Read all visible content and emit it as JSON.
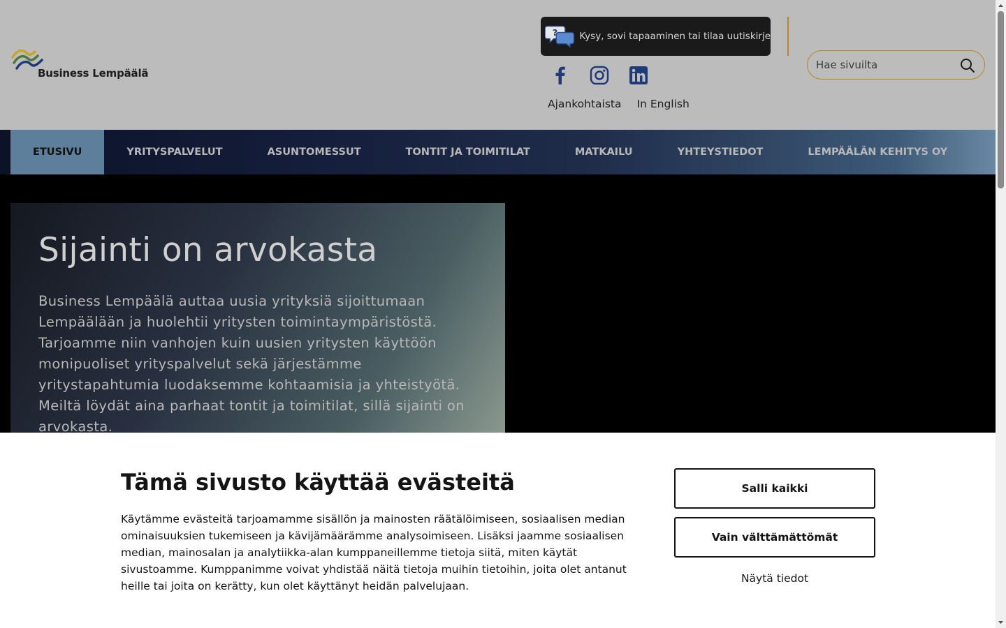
{
  "header": {
    "logo_text": "Business Lempäälä",
    "ask_label": "Kysy, sovi tapaaminen tai tilaa uutiskirje",
    "search_placeholder": "Hae sivuilta",
    "social": [
      "facebook-icon",
      "instagram-icon",
      "linkedin-icon"
    ],
    "links": [
      "Ajankohtaista",
      "In English"
    ]
  },
  "nav": {
    "items": [
      {
        "label": "ETUSIVU",
        "active": true
      },
      {
        "label": "YRITYSPALVELUT"
      },
      {
        "label": "ASUNTOMESSUT"
      },
      {
        "label": "TONTIT JA TOIMITILAT"
      },
      {
        "label": "MATKAILU"
      },
      {
        "label": "YHTEYSTIEDOT"
      },
      {
        "label": "LEMPÄÄLÄN KEHITYS OY"
      }
    ]
  },
  "hero": {
    "title": "Sijainti on arvokasta",
    "text": "Business Lempäälä auttaa uusia yrityksiä sijoittumaan Lempäälään ja huolehtii yritysten toimintaympäristöstä. Tarjoamme niin vanhojen kuin uusien yritysten käyttöön monipuoliset yrityspalvelut sekä järjestämme yritystapahtumia luodaksemme kohtaamisia ja yhteistyötä. Meiltä löydät aina parhaat tontit ja toimitilat, sillä sijainti on arvokasta."
  },
  "cookie": {
    "title": "Tämä sivusto käyttää evästeitä",
    "text": "Käytämme evästeitä tarjoamamme sisällön ja mainosten räätälöimiseen, sosiaalisen median ominaisuuksien tukemiseen ja kävijämäärämme analysoimiseen. Lisäksi jaamme sosiaalisen median, mainosalan ja analytiikka-alan kumppaneillemme tietoja siitä, miten käytät sivustoamme. Kumppanimme voivat yhdistää näitä tietoja muihin tietoihin, joita olet antanut heille tai joita on kerätty, kun olet käyttänyt heidän palvelujaan.",
    "allow_all": "Salli kaikki",
    "necessary_only": "Vain välttämättömät",
    "show_details": "Näytä tiedot"
  },
  "colors": {
    "accent_gold": "#b08a2a",
    "nav_active": "#5e7f9b"
  }
}
